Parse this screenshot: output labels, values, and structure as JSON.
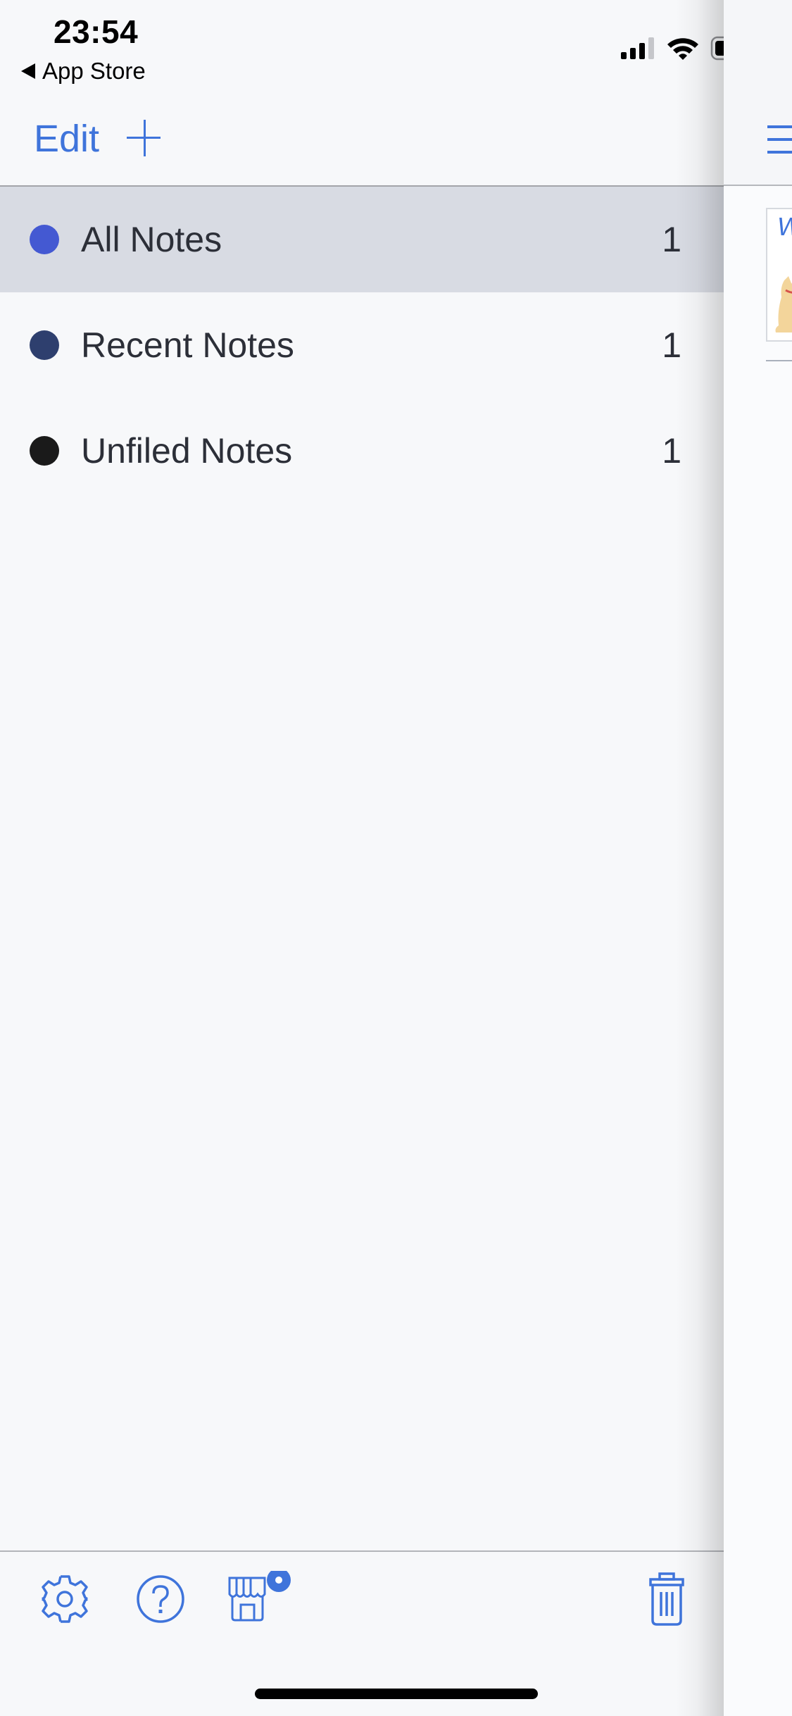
{
  "status_bar": {
    "time": "23:54",
    "back_app": "App Store",
    "signal_bars_active": 3,
    "signal_bars_total": 4,
    "battery_level": 0.55
  },
  "nav": {
    "edit_label": "Edit",
    "add_icon": "plus-icon"
  },
  "notebooks": [
    {
      "label": "All Notes",
      "count": "1",
      "color": "#4459d2",
      "selected": true
    },
    {
      "label": "Recent Notes",
      "count": "1",
      "color": "#2e3f6e",
      "selected": false
    },
    {
      "label": "Unfiled Notes",
      "count": "1",
      "color": "#1a1a1a",
      "selected": false
    }
  ],
  "toolbar": {
    "icons": [
      "gear-icon",
      "help-icon",
      "store-icon",
      "trash-icon"
    ],
    "store_badge": true
  },
  "right_panel": {
    "menu_icon": "menu-icon",
    "note_thumbnail_title": "W"
  },
  "colors": {
    "accent": "#3f74db",
    "selected_row": "#d8dbe3",
    "text": "#2c2f38"
  }
}
